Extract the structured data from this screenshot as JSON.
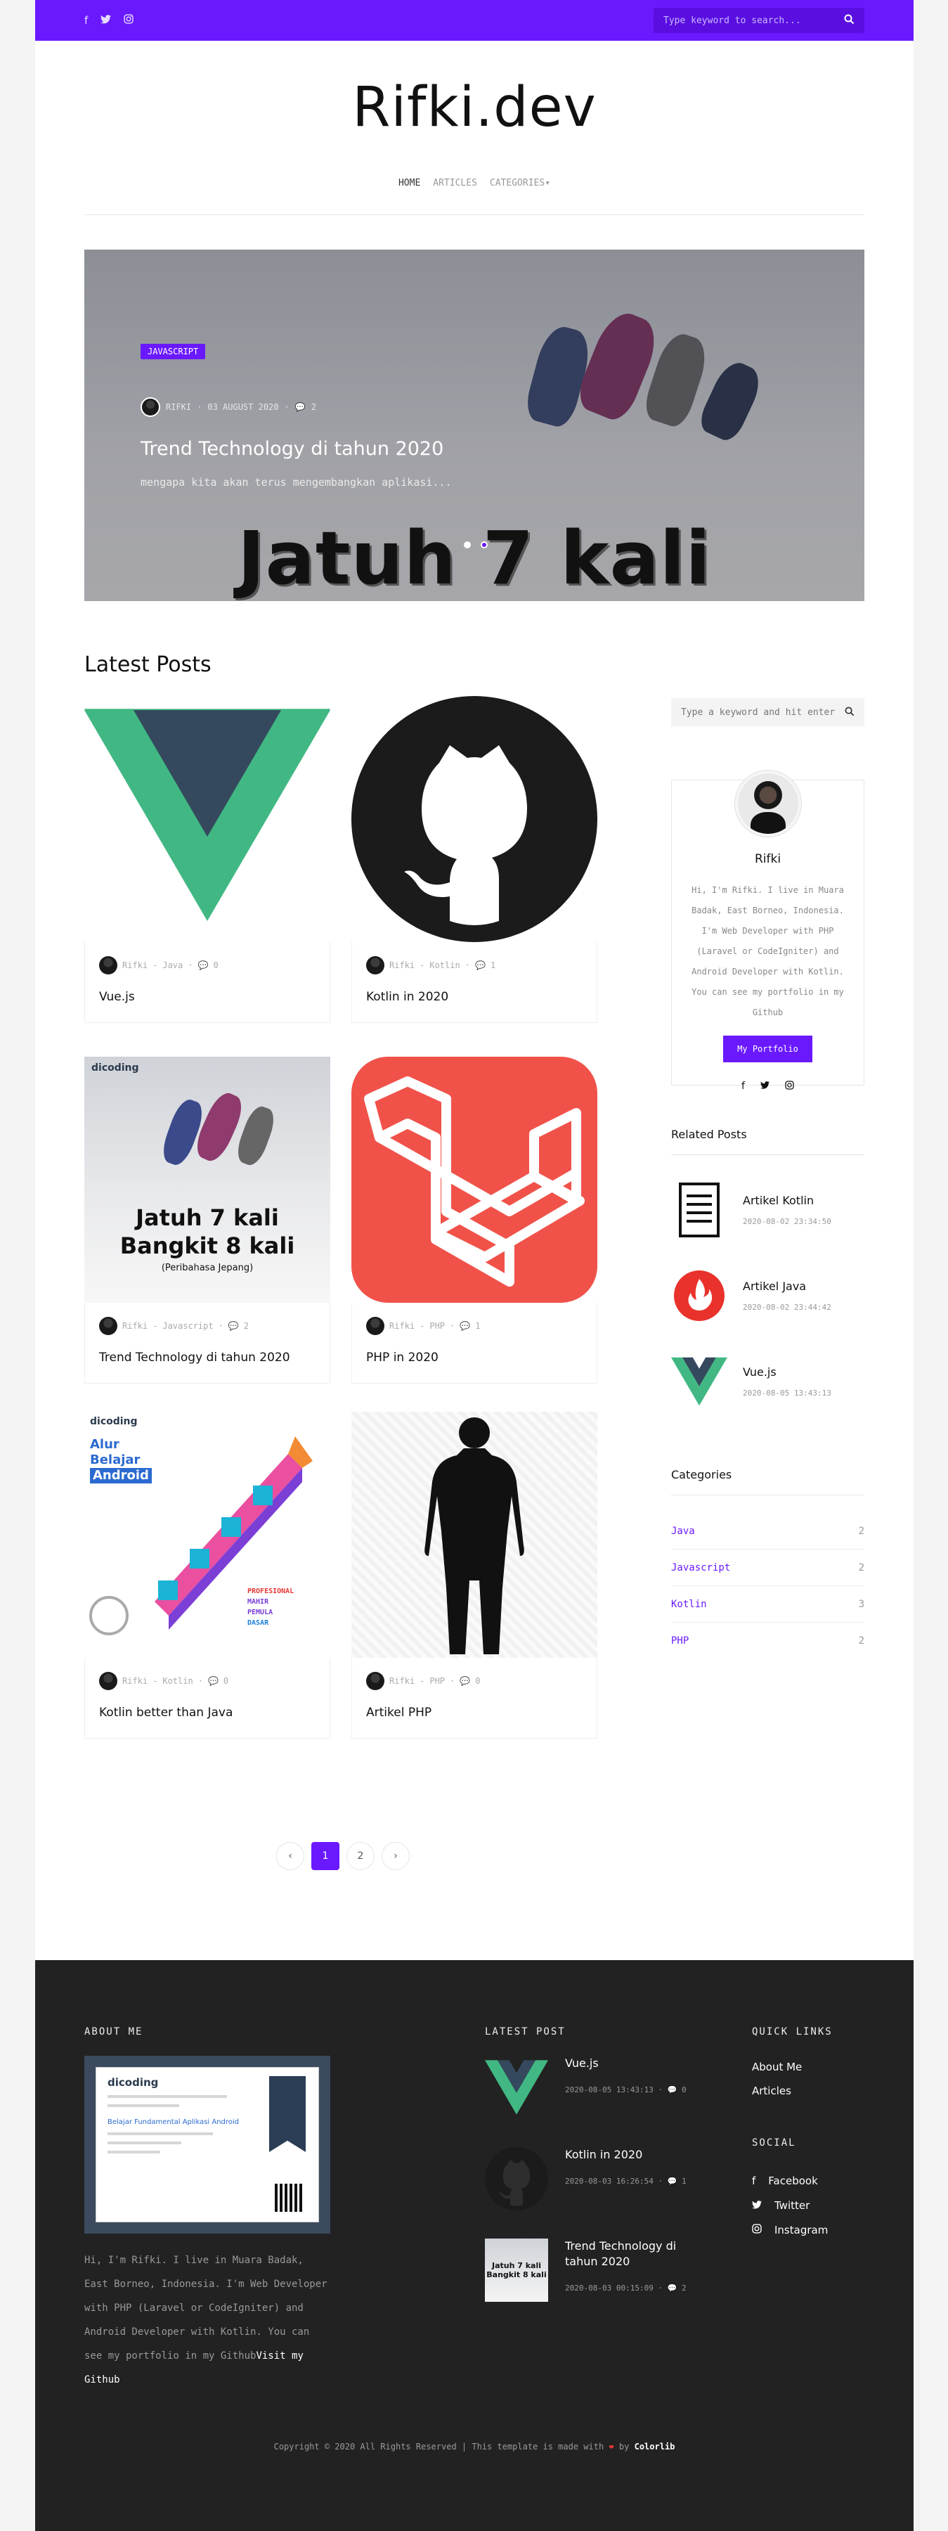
{
  "topbar": {
    "search_placeholder": "Type keyword to search...",
    "social_icons": [
      "facebook-icon",
      "twitter-icon",
      "instagram-icon"
    ],
    "accent": "#6a19ff"
  },
  "brand": "Rifki.dev",
  "nav": {
    "home": "HOME",
    "articles": "ARTICLES",
    "categories": "CATEGORIES"
  },
  "hero": {
    "badge": "JAVASCRIPT",
    "author": "RIFKI",
    "date": "03 AUGUST 2020",
    "comments": "2",
    "title": "Trend Technology di tahun 2020",
    "subtitle": "mengapa kita akan terus mengembangkan aplikasi...",
    "overlay_text": "Jatuh 7 kali"
  },
  "latest_title": "Latest Posts",
  "posts": [
    {
      "author": "Rifki",
      "category": "Java",
      "comments": "0",
      "title": "Vue.js"
    },
    {
      "author": "Rifki",
      "category": "Kotlin",
      "comments": "1",
      "title": "Kotlin in 2020"
    },
    {
      "author": "Rifki",
      "category": "Javascript",
      "comments": "2",
      "title": "Trend Technology di tahun 2020"
    },
    {
      "author": "Rifki",
      "category": "PHP",
      "comments": "1",
      "title": "PHP in 2020"
    },
    {
      "author": "Rifki",
      "category": "Kotlin",
      "comments": "0",
      "title": "Kotlin better than Java"
    },
    {
      "author": "Rifki",
      "category": "PHP",
      "comments": "0",
      "title": "Artikel PHP"
    }
  ],
  "thumbs": {
    "trend_line1": "Jatuh 7 kali",
    "trend_line2": "Bangkit 8 kali",
    "trend_line3": "(Peribahasa Jepang)",
    "dicoding": "dicoding",
    "alur1": "Alur",
    "alur2": "Belajar",
    "alur3": "Android",
    "levels": [
      "PROFESIONAL",
      "MAHIR",
      "PEMULA",
      "DASAR"
    ]
  },
  "sidebar": {
    "search_placeholder": "Type a keyword and hit enter",
    "profile_name": "Rifki",
    "profile_bio": "Hi, I'm Rifki. I live in Muara Badak, East Borneo, Indonesia. I'm Web Developer with PHP (Laravel or CodeIgniter) and Android Developer with Kotlin. You can see my portfolio in my Github",
    "portfolio_button": "My Portfolio",
    "related_title": "Related Posts",
    "related": [
      {
        "title": "Artikel Kotlin",
        "date": "2020-08-02 23:34:50"
      },
      {
        "title": "Artikel Java",
        "date": "2020-08-02 23:44:42"
      },
      {
        "title": "Vue.js",
        "date": "2020-08-05 13:43:13"
      }
    ],
    "categories_title": "Categories",
    "categories": [
      {
        "name": "Java",
        "count": "2"
      },
      {
        "name": "Javascript",
        "count": "2"
      },
      {
        "name": "Kotlin",
        "count": "3"
      },
      {
        "name": "PHP",
        "count": "2"
      }
    ]
  },
  "pagination": {
    "prev": "‹",
    "pages": [
      "1",
      "2"
    ],
    "next": "›"
  },
  "footer": {
    "about_title": "ABOUT ME",
    "about_text": "Hi, I'm Rifki. I live in Muara Badak, East Borneo, Indonesia. I'm Web Developer with PHP (Laravel or CodeIgniter) and Android Developer with Kotlin. You can see my portfolio in my Github",
    "about_link": "Visit my Github",
    "cert_logo": "dicoding",
    "cert_course": "Belajar Fundamental Aplikasi Android",
    "latest_title": "LATEST POST",
    "latest": [
      {
        "title": "Vue.js",
        "date": "2020-08-05 13:43:13",
        "comments": "0"
      },
      {
        "title": "Kotlin in 2020",
        "date": "2020-08-03 16:26:54",
        "comments": "1"
      },
      {
        "title": "Trend Technology di tahun 2020",
        "date": "2020-08-03 00:15:09",
        "comments": "2"
      }
    ],
    "quick_title": "QUICK LINKS",
    "quick_links": [
      "About Me",
      "Articles"
    ],
    "social_title": "SOCIAL",
    "socials": [
      "Facebook",
      "Twitter",
      "Instagram"
    ],
    "copyright": "Copyright © 2020 All Rights Reserved | This template is made with",
    "by": "by",
    "credit": "Colorlib"
  }
}
